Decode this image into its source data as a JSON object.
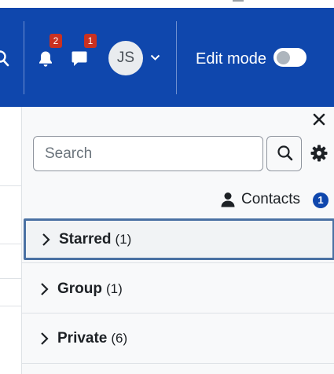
{
  "navbar": {
    "notifications": {
      "icon": "bell-icon",
      "count": "2"
    },
    "messages": {
      "icon": "chat-icon",
      "count": "1"
    },
    "user": {
      "initials": "JS"
    },
    "edit_mode_label": "Edit mode",
    "edit_mode_on": false,
    "color": "#0f47ad"
  },
  "drawer": {
    "search": {
      "placeholder": "Search"
    },
    "contacts": {
      "label": "Contacts",
      "count": "1"
    },
    "sections": [
      {
        "label": "Starred",
        "count": "(1)"
      },
      {
        "label": "Group",
        "count": "(1)"
      },
      {
        "label": "Private",
        "count": "(6)"
      }
    ]
  }
}
